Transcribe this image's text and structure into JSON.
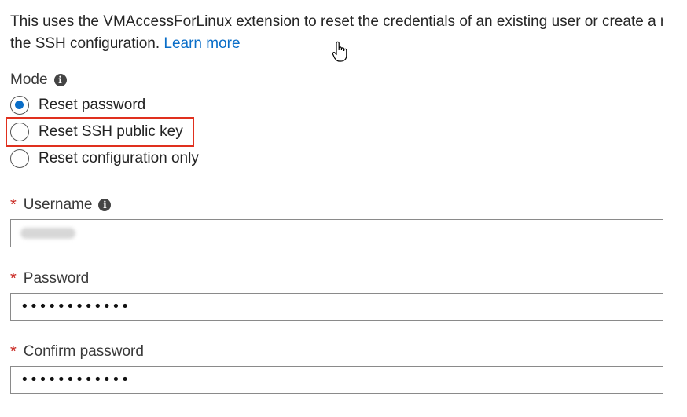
{
  "description": {
    "line1": "This uses the VMAccessForLinux extension to reset the credentials of an existing user or create a n",
    "line2": "the SSH configuration.",
    "learn_more": "Learn more"
  },
  "mode": {
    "label": "Mode",
    "options": [
      {
        "label": "Reset password",
        "selected": true
      },
      {
        "label": "Reset SSH public key",
        "selected": false
      },
      {
        "label": "Reset configuration only",
        "selected": false
      }
    ]
  },
  "username": {
    "label": "Username",
    "required_mark": "*"
  },
  "password": {
    "label": "Password",
    "required_mark": "*",
    "value": "••••••••••••"
  },
  "confirm_password": {
    "label": "Confirm password",
    "required_mark": "*",
    "value": "••••••••••••"
  },
  "colors": {
    "accent": "#0a6ec8",
    "required": "#c8221c",
    "highlight": "#e0301e"
  }
}
